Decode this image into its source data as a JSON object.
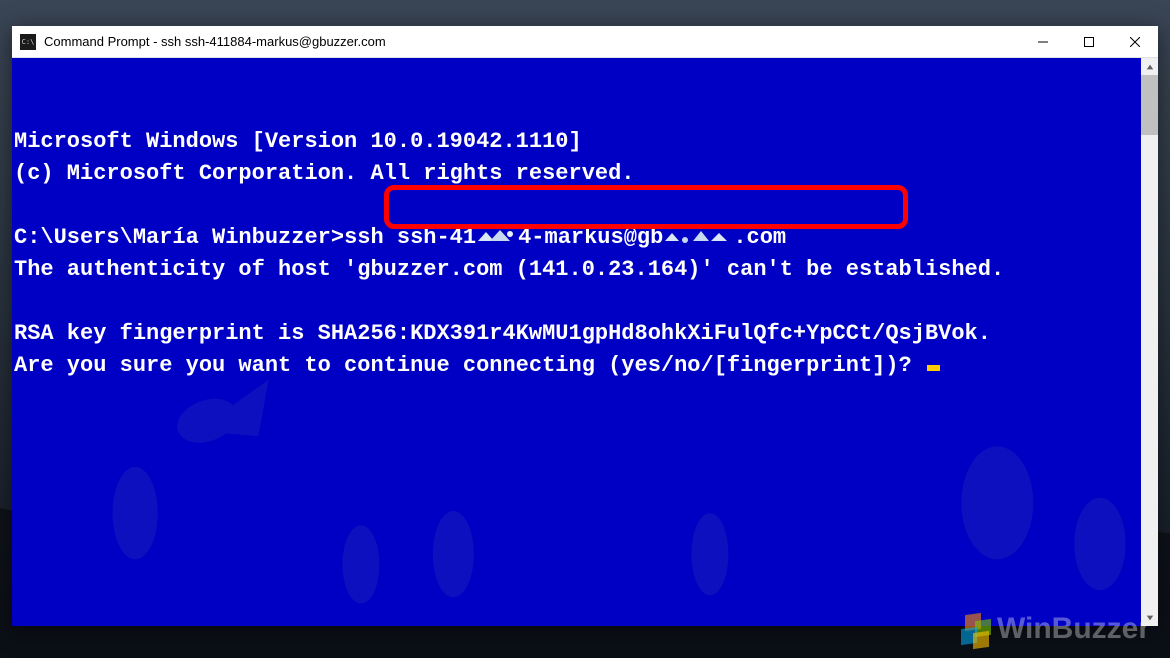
{
  "titlebar": {
    "icon_label": "C:\\",
    "title": "Command Prompt - ssh  ssh-411884-markus@gbuzzer.com"
  },
  "terminal": {
    "line1": "Microsoft Windows [Version 10.0.19042.1110]",
    "line2": "(c) Microsoft Corporation. All rights reserved.",
    "blank1": "",
    "prompt_prefix": "C:\\Users\\María Winbuzzer>",
    "cmd_part1": "ssh ssh-41",
    "cmd_part2": "4-markus@gb",
    "cmd_part3": ".com",
    "line4": "The authenticity of host 'gbuzzer.com (141.0.23.164)' can't be established.",
    "blank2": "",
    "line5": "RSA key fingerprint is SHA256:KDX391r4KwMU1gpHd8ohkXiFulQfc+YpCCt/QsjBVok.",
    "line6": "Are you sure you want to continue connecting (yes/no/[fingerprint])? "
  },
  "watermark": {
    "text": "WinBuzzer"
  }
}
